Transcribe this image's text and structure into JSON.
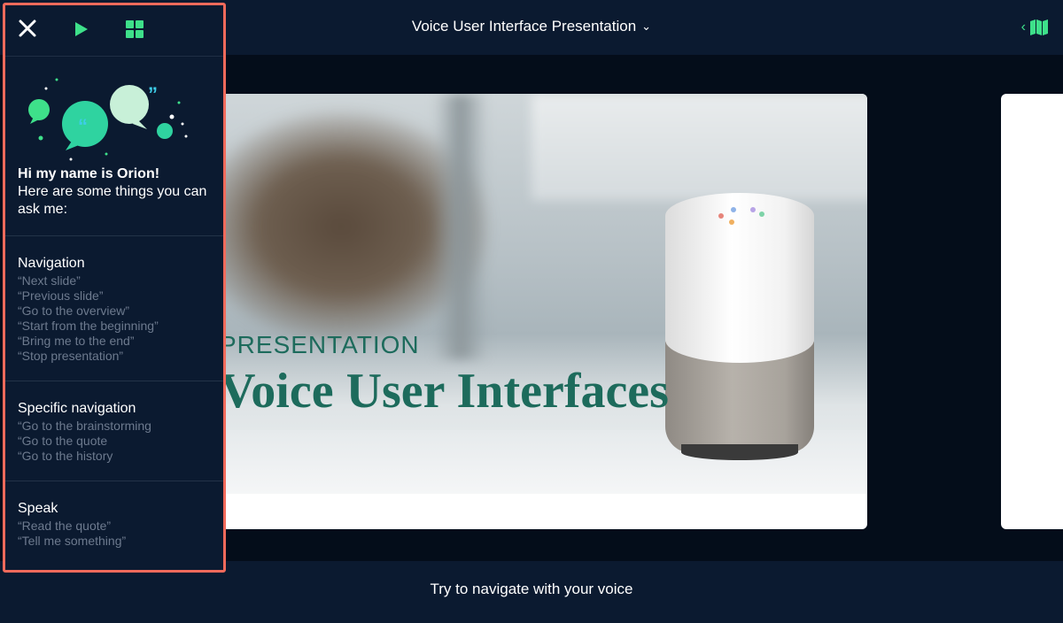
{
  "header": {
    "title": "Voice User Interface Presentation",
    "title_chevron": "⌄",
    "map_chevron": "‹"
  },
  "slide": {
    "kicker": "PRESENTATION",
    "title": "Voice User Interfaces"
  },
  "footer": {
    "hint": "Try to navigate with your voice"
  },
  "panel": {
    "greeting_bold": "Hi my name is Orion!",
    "greeting_rest": "Here are some things you can ask me:",
    "sections": [
      {
        "title": "Navigation",
        "commands": [
          "“Next slide”",
          "“Previous slide”",
          "“Go to the overview”",
          "“Start from the beginning”",
          "“Bring me to the end”",
          "“Stop presentation”"
        ]
      },
      {
        "title": "Specific navigation",
        "commands": [
          "“Go to the brainstorming",
          "“Go to the quote",
          "“Go to the history"
        ]
      },
      {
        "title": "Speak",
        "commands": [
          "“Read the quote”",
          "“Tell me something”"
        ]
      }
    ]
  },
  "colors": {
    "accent": "#3ee08a",
    "panel_border": "#f26a5b",
    "background": "#040d1a",
    "bar": "#0b1a30",
    "slide_title": "#1d6b5c",
    "command_text": "#6d7a8e"
  },
  "icons": [
    "close-icon",
    "play-icon",
    "grid-icon",
    "chevron-down-icon",
    "chevron-left-icon",
    "map-icon",
    "speech-bubbles-illustration"
  ]
}
